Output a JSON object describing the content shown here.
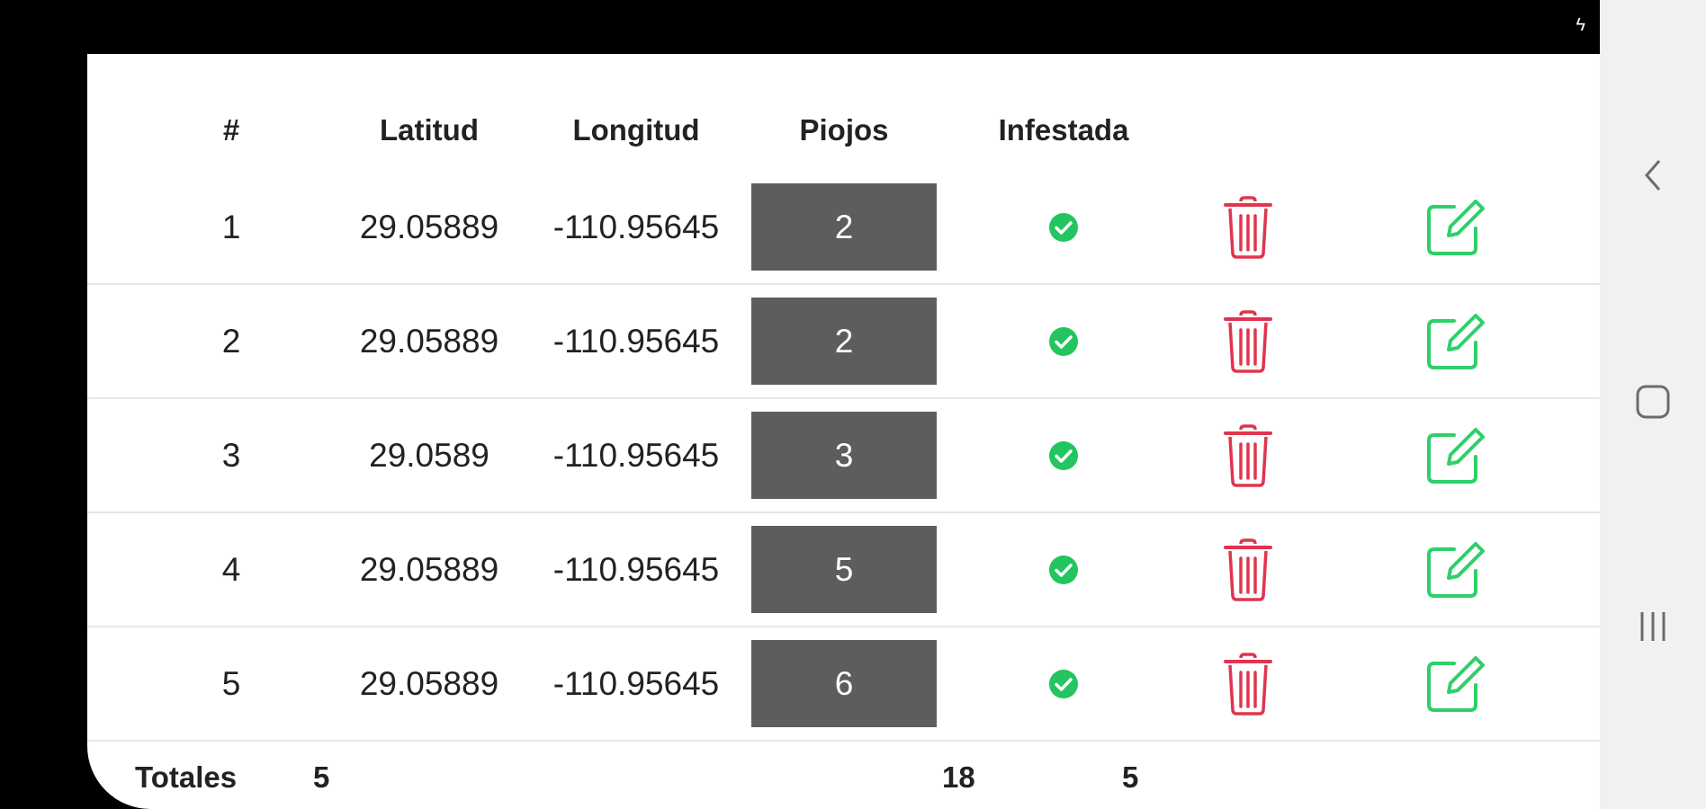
{
  "colors": {
    "pill_bg": "#5d5d5d",
    "check_green": "#22c55e",
    "trash_red": "#e0354f",
    "edit_green": "#2fcf6a"
  },
  "table": {
    "headers": {
      "num": "#",
      "lat": "Latitud",
      "lon": "Longitud",
      "piojos": "Piojos",
      "infestada": "Infestada"
    },
    "rows": [
      {
        "num": "1",
        "lat": "29.05889",
        "lon": "-110.95645",
        "piojos": "2",
        "infestada_icon": "check-circle-icon"
      },
      {
        "num": "2",
        "lat": "29.05889",
        "lon": "-110.95645",
        "piojos": "2",
        "infestada_icon": "check-circle-icon"
      },
      {
        "num": "3",
        "lat": "29.0589",
        "lon": "-110.95645",
        "piojos": "3",
        "infestada_icon": "check-circle-icon"
      },
      {
        "num": "4",
        "lat": "29.05889",
        "lon": "-110.95645",
        "piojos": "5",
        "infestada_icon": "check-circle-icon"
      },
      {
        "num": "5",
        "lat": "29.05889",
        "lon": "-110.95645",
        "piojos": "6",
        "infestada_icon": "check-circle-icon"
      }
    ],
    "totals": {
      "label": "Totales",
      "count": "5",
      "piojos": "18",
      "infestada": "5"
    }
  },
  "icons": {
    "row_actions": [
      "trash-icon",
      "edit-icon"
    ],
    "status_bar": "charging-icon",
    "nav": [
      "back-icon",
      "home-icon",
      "recent-apps-icon"
    ]
  }
}
